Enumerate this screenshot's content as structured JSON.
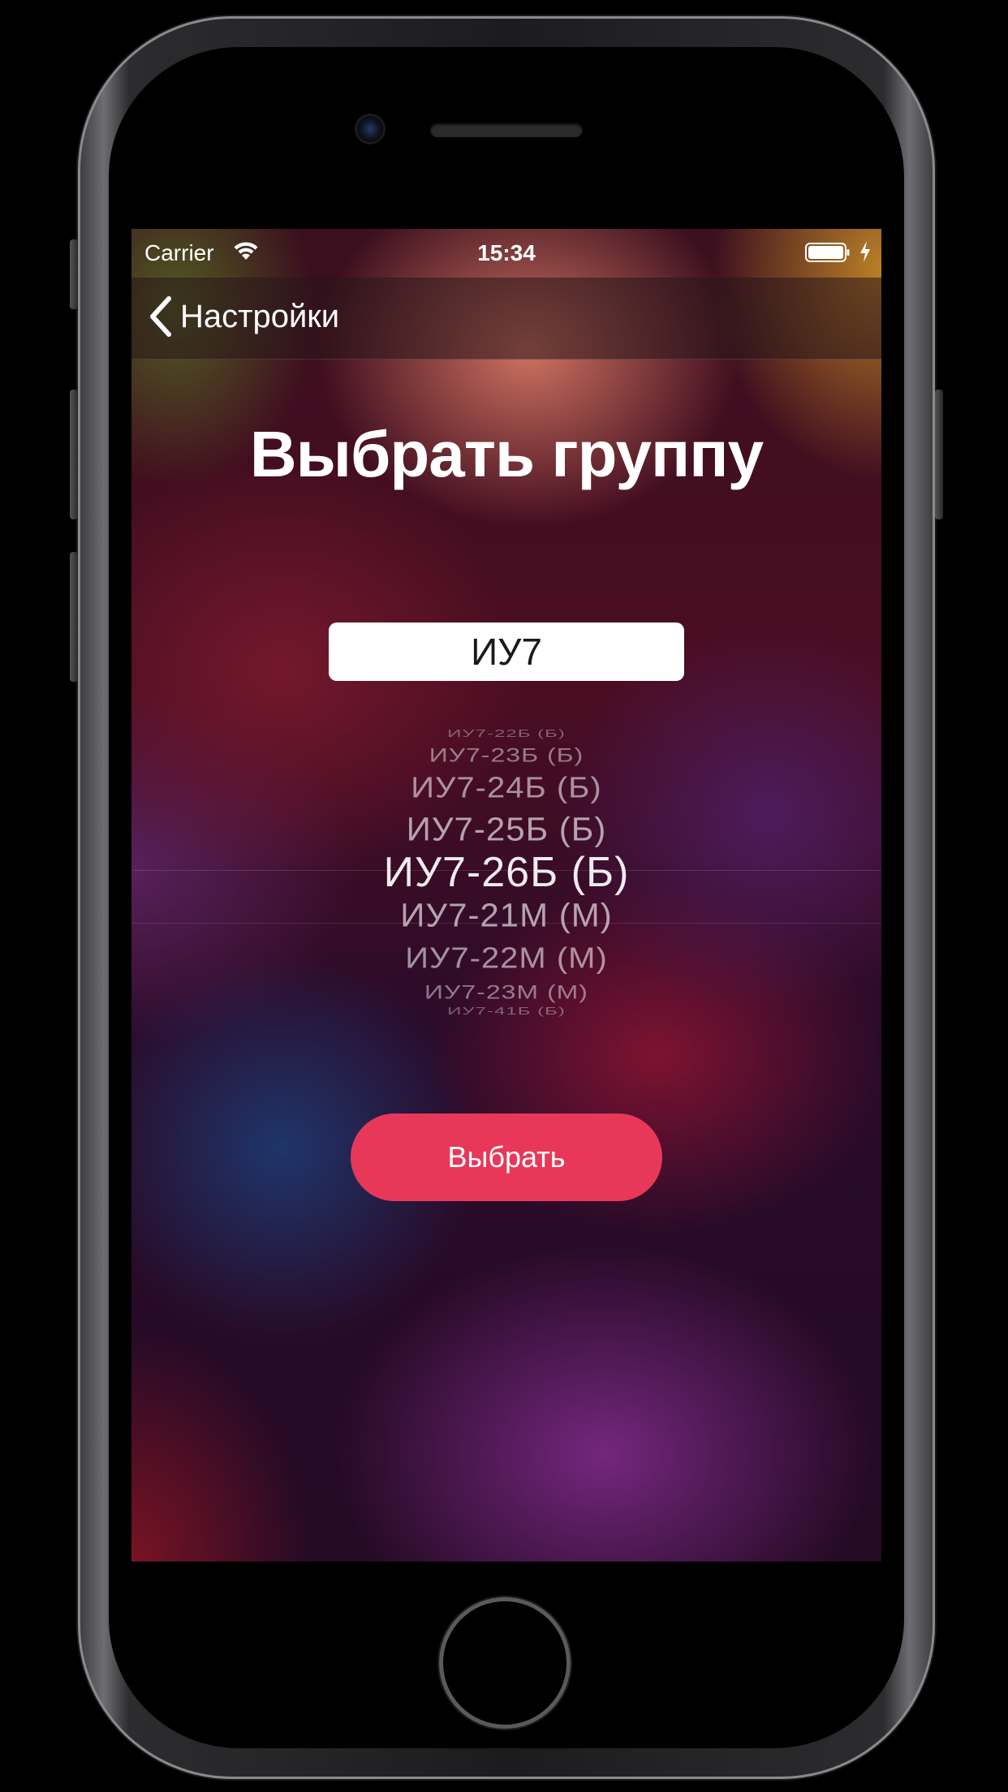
{
  "status_bar": {
    "carrier": "Carrier",
    "time": "15:34"
  },
  "nav_bar": {
    "back_label": "Настройки"
  },
  "page": {
    "title": "Выбрать группу"
  },
  "search": {
    "value": "ИУ7"
  },
  "picker": {
    "items": [
      "ИУ7-22Б (Б)",
      "ИУ7-23Б (Б)",
      "ИУ7-24Б (Б)",
      "ИУ7-25Б (Б)",
      "ИУ7-26Б (Б)",
      "ИУ7-21М (М)",
      "ИУ7-22М (М)",
      "ИУ7-23М (М)",
      "ИУ7-41Б (Б)"
    ],
    "selected_index": 4
  },
  "select_button": {
    "label": "Выбрать"
  },
  "colors": {
    "accent": "#e8385a",
    "text": "#ffffff"
  },
  "icons": [
    "wifi-icon",
    "battery-icon",
    "charging-bolt-icon",
    "back-chevron-icon",
    "camera-icon",
    "speaker-icon",
    "home-button"
  ]
}
